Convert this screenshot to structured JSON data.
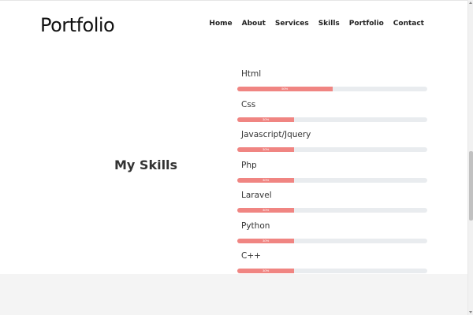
{
  "header": {
    "brand": "Portfolio",
    "nav": [
      "Home",
      "About",
      "Services",
      "Skills",
      "Portfolio",
      "Contact"
    ]
  },
  "skills_section": {
    "heading": "My Skills",
    "items": [
      {
        "label": "Html",
        "percent": 50,
        "percent_text": "50%"
      },
      {
        "label": "Css",
        "percent": 30,
        "percent_text": "30%"
      },
      {
        "label": "Javascript/Jquery",
        "percent": 30,
        "percent_text": "30%"
      },
      {
        "label": "Php",
        "percent": 30,
        "percent_text": "30%"
      },
      {
        "label": "Laravel",
        "percent": 30,
        "percent_text": "30%"
      },
      {
        "label": "Python",
        "percent": 30,
        "percent_text": "30%"
      },
      {
        "label": "C++",
        "percent": 30,
        "percent_text": "30%"
      }
    ]
  },
  "colors": {
    "bar_fill": "#f08582",
    "bar_track": "#e9ecef",
    "footer_band": "#f4f4f4"
  }
}
